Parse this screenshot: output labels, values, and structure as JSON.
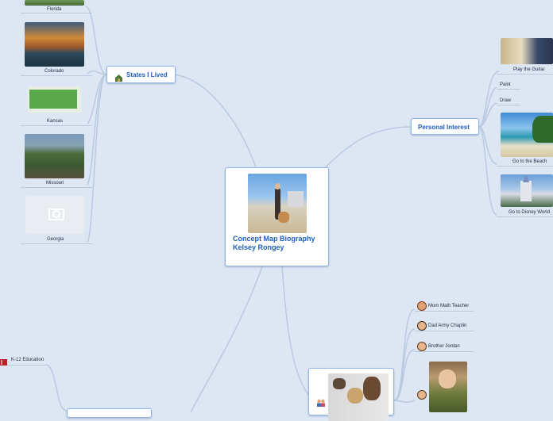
{
  "central": {
    "title": "Concept Map Biography Kelsey Rongey"
  },
  "states": {
    "label": "States I Lived",
    "icon": "house-icon",
    "items": [
      {
        "label": "Florida"
      },
      {
        "label": "Colorado"
      },
      {
        "label": "Kansas"
      },
      {
        "label": "Missouri"
      },
      {
        "label": "Georgia"
      }
    ]
  },
  "interests": {
    "label": "Personal Interest",
    "items": [
      {
        "label": "Play the Guitar"
      },
      {
        "label": "Paint"
      },
      {
        "label": "Draw"
      },
      {
        "label": "Go to the Beach"
      },
      {
        "label": "Go to Disney World"
      }
    ]
  },
  "family": {
    "icon": "family-icon",
    "items": [
      {
        "label": "Mom Math Teacher",
        "icon": "woman-icon"
      },
      {
        "label": "Dad Army Chaplin",
        "icon": "man-icon"
      },
      {
        "label": "Brother Jordan",
        "icon": "boy-icon"
      },
      {
        "label": "",
        "icon": "girl-icon"
      }
    ]
  },
  "education": {
    "items": [
      {
        "label": "K-12 Education",
        "icon": "book-icon"
      }
    ]
  },
  "colors": {
    "background": "#dde7f4",
    "topic_text": "#1f5fbf",
    "connector": "#b8c9e0",
    "topic_border": "#8fb4e8"
  }
}
